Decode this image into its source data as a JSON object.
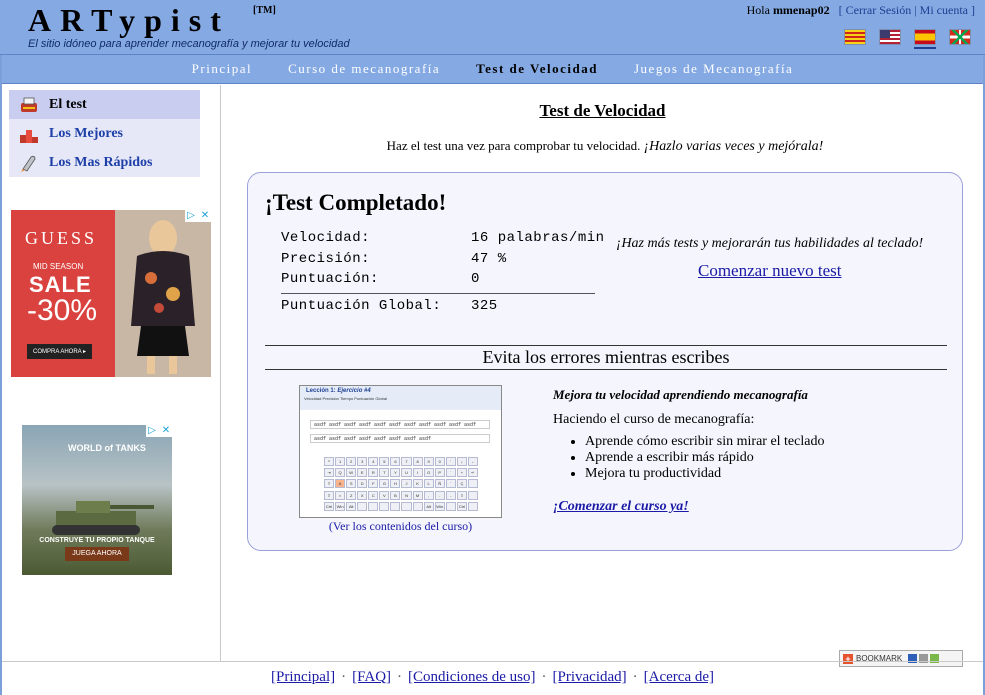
{
  "header": {
    "logo": "ARTypist",
    "tm": "[TM]",
    "tagline": "El sitio idóneo para aprender mecanografía y mejorar tu velocidad",
    "greeting": "Hola",
    "username": "mmenap02",
    "logout": "Cerrar Sesión",
    "account": "Mi cuenta",
    "bracket_open": "[",
    "bracket_close": "]",
    "separator": "|"
  },
  "flags": [
    "catalan-flag-icon",
    "us-flag-icon",
    "spain-flag-icon",
    "basque-flag-icon"
  ],
  "nav": {
    "items": [
      "Principal",
      "Curso de mecanografía",
      "Test de Velocidad",
      "Juegos de Mecanografía"
    ],
    "active_index": 2
  },
  "sidebar": {
    "items": [
      {
        "label": "El test",
        "icon": "typewriter-icon"
      },
      {
        "label": "Los Mejores",
        "icon": "podium-icon"
      },
      {
        "label": "Los Mas Rápidos",
        "icon": "rocket-icon"
      }
    ]
  },
  "ads": {
    "ad1": {
      "brand": "GUESS",
      "line1": "MID SEASON",
      "line2": "SALE",
      "line3": "-30%",
      "cta": "COMPRA AHORA ▸"
    },
    "ad2": {
      "brand": "WORLD of TANKS",
      "line1": "CONSTRUYE TU PROPIO TANQUE",
      "cta": "JUEGA AHORA"
    }
  },
  "main": {
    "title": "Test de Velocidad",
    "intro": "Haz el test una vez para comprobar tu velocidad.",
    "intro_italic": "¡Hazlo varias veces y mejórala!",
    "result_title": "¡Test Completado!",
    "stats": {
      "speed_label": "Velocidad:",
      "speed_value": "16 palabras/min",
      "precision_label": "Precisión:",
      "precision_value": "47 %",
      "score_label": "Puntuación:",
      "score_value": "0",
      "global_label": "Puntuación Global:",
      "global_value": "325"
    },
    "encourage": "¡Haz más tests y mejorarán tus habilidades al teclado!",
    "new_test": "Comenzar nuevo test",
    "avoid_errors": "Evita los errores mientras escribes",
    "course_caption": "(Ver los contenidos del curso)",
    "promo_head": "Mejora tu velocidad aprendiendo mecanografía",
    "promo_sub": "Haciendo el curso de mecanografía:",
    "promo_points": [
      "Aprende cómo escribir sin mirar el teclado",
      "Aprende a escribir más rápido",
      "Mejora tu productividad"
    ],
    "promo_link": "¡Comenzar el curso ya!"
  },
  "course_shot": {
    "lesson": "Lección 1:",
    "exercise": "Ejercicio #4",
    "meta": "Velocidad  Precisión  Tiempo        Puntuación Global",
    "line1": "asdf asdf asdf asdf asdf asdf asdf asdf asdf asdf asdf",
    "line2": "asdf asdf asdf asdf asdf asdf asdf asdf"
  },
  "footer": {
    "links": [
      "[Principal]",
      "[FAQ]",
      "[Condiciones de uso]",
      "[Privacidad]",
      "[Acerca de]"
    ],
    "dot": "·"
  },
  "bookmark": {
    "label": "BOOKMARK"
  },
  "colors": {
    "header": "#85a9e3",
    "link": "#1a1aa6",
    "box": "#f4f5fd",
    "box_border": "#9aa0d8"
  }
}
